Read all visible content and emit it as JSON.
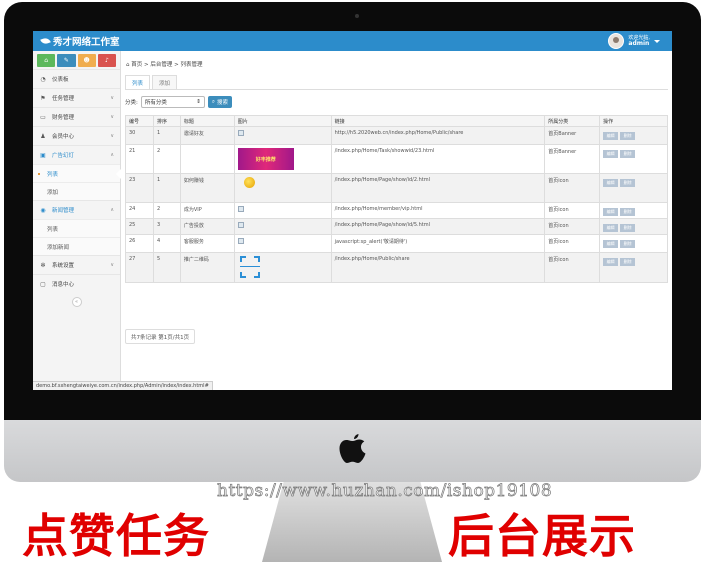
{
  "app": {
    "brand": "秀才网络工作室",
    "user_greeting": "欢迎光临,",
    "user_name": "admin"
  },
  "shortcuts": [
    {
      "icon": "home-icon",
      "color": "#5cb85c",
      "glyph": "⌂"
    },
    {
      "icon": "pencil-icon",
      "color": "#3c8dbc",
      "glyph": "✎"
    },
    {
      "icon": "users-icon",
      "color": "#f0ad4e",
      "glyph": "☻"
    },
    {
      "icon": "bell-icon",
      "color": "#d9534f",
      "glyph": "♪"
    }
  ],
  "sidebar": {
    "items": [
      {
        "icon": "dashboard-icon",
        "label": "仪表板"
      },
      {
        "icon": "flag-icon",
        "label": "任务管理"
      },
      {
        "icon": "finance-icon",
        "label": "财务管理"
      },
      {
        "icon": "user-icon",
        "label": "会员中心"
      },
      {
        "icon": "image-icon",
        "label": "广告幻灯"
      },
      {
        "icon": "globe-icon",
        "label": "新闻管理"
      },
      {
        "icon": "cog-icon",
        "label": "系统设置"
      },
      {
        "icon": "message-icon",
        "label": "消息中心"
      }
    ],
    "ads_sub": [
      "列表",
      "添加"
    ],
    "news_sub": [
      "列表",
      "添加新闻"
    ]
  },
  "breadcrumb": "首页 > 后台管理 > 列表管理",
  "tabs": [
    "列表",
    "添加"
  ],
  "filter": {
    "label": "分类:",
    "selected": "所有分类",
    "search_label": "搜索"
  },
  "table": {
    "headers": [
      "编号",
      "排序",
      "标题",
      "图片",
      "链接",
      "所属分类",
      "操作"
    ],
    "edit_label": "编辑",
    "delete_label": "删除",
    "rows": [
      {
        "id": "30",
        "sort": "1",
        "title": "邀请好友",
        "image": "broken",
        "link": "http://h5.2020web.cn/index.php/Home/Public/share",
        "category": "首页Banner"
      },
      {
        "id": "21",
        "sort": "2",
        "title": "",
        "image": "banner",
        "image_text": "好丰推荐",
        "link": "/index.php/Home/Task/showwid/23.html",
        "category": "首页Banner"
      },
      {
        "id": "23",
        "sort": "1",
        "title": "如何赚钱",
        "image": "icon",
        "link": "/index.php/Home/Page/show/id/2.html",
        "category": "首页icon"
      },
      {
        "id": "24",
        "sort": "2",
        "title": "成为VIP",
        "image": "broken",
        "link": "/index.php/Home/member/vip.html",
        "category": "首页icon"
      },
      {
        "id": "25",
        "sort": "3",
        "title": "广告投放",
        "image": "broken",
        "link": "/index.php/Home/Page/show/id/5.html",
        "category": "首页icon"
      },
      {
        "id": "26",
        "sort": "4",
        "title": "客服服务",
        "image": "broken",
        "link": "javascript:sp_alert('敬请期待')",
        "category": "首页icon"
      },
      {
        "id": "27",
        "sort": "5",
        "title": "推广二维码",
        "image": "qr",
        "link": "/index.php/Home/Public/share",
        "category": "首页icon"
      }
    ]
  },
  "pager": "共7条记录 第1页/共1页",
  "status_url": "demo.bf.sxhengtaiweiye.com.cn/index.php/Admin/index/index.html#",
  "watermark": "https://www.huzhan.com/ishop19108",
  "promo": {
    "left": "点赞任务",
    "right": "后台展示",
    "color": "#e00000"
  },
  "colors": {
    "topbar": "#2c8ccb",
    "accent": "#3c8dbc"
  }
}
